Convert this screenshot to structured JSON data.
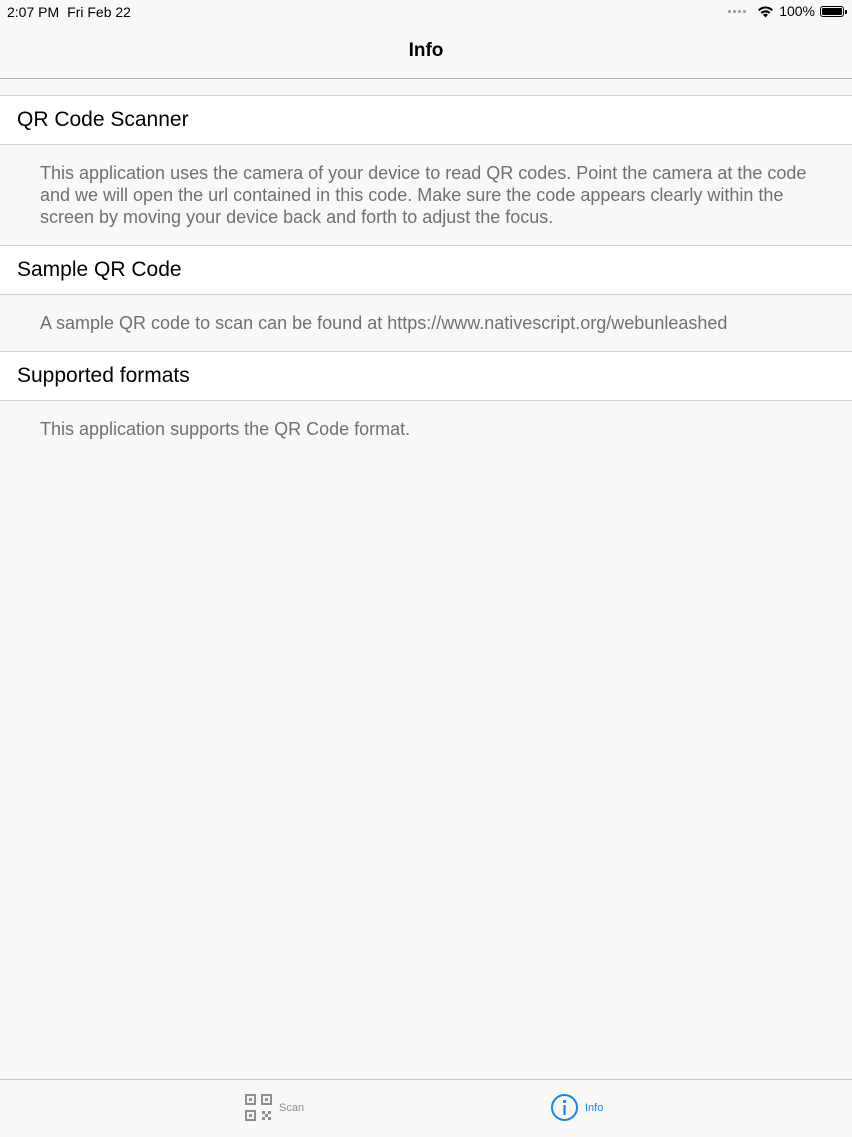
{
  "status_bar": {
    "time": "2:07 PM",
    "date": "Fri Feb 22",
    "battery": "100%",
    "wifi_icon": "wifi-icon",
    "battery_icon": "battery-icon"
  },
  "nav": {
    "title": "Info"
  },
  "sections": [
    {
      "header": "QR Code Scanner",
      "body": "This application uses the camera of your device to read QR codes. Point the camera at the code and we will open the url contained in this code. Make sure the code appears clearly within the screen by moving your device back and forth to adjust the focus."
    },
    {
      "header": "Sample QR Code",
      "body": "A sample QR code to scan can be found at https://www.nativescript.org/webunleashed"
    },
    {
      "header": "Supported formats",
      "body": "This application supports the QR Code format."
    }
  ],
  "tabs": [
    {
      "label": "Scan",
      "icon": "qr-code-icon",
      "selected": false,
      "color": "#8e8e8e"
    },
    {
      "label": "Info",
      "icon": "info-icon",
      "selected": true,
      "color": "#1a82f0"
    }
  ]
}
